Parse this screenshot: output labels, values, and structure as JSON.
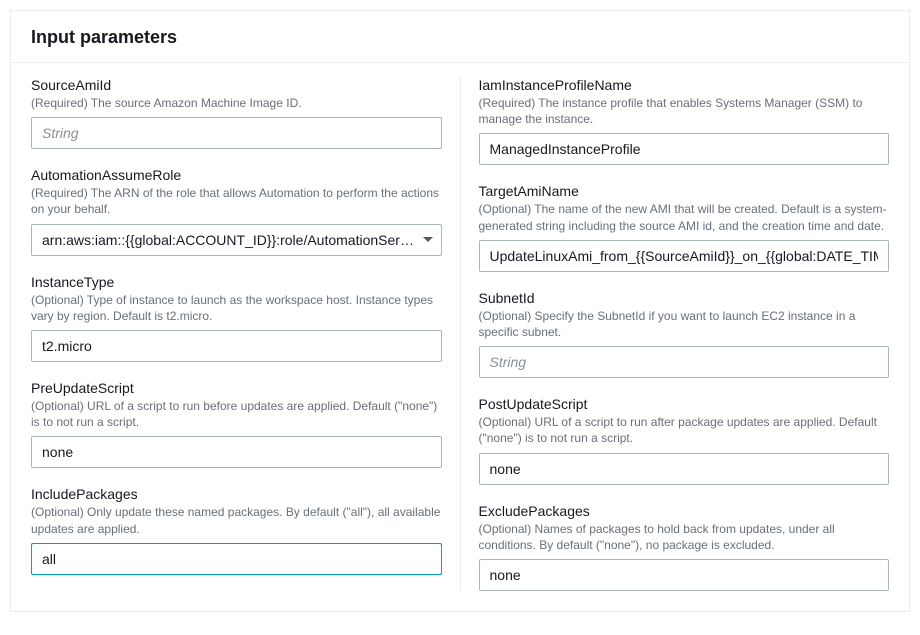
{
  "header": {
    "title": "Input parameters"
  },
  "placeholders": {
    "string": "String"
  },
  "left": {
    "sourceAmiId": {
      "label": "SourceAmiId",
      "desc": "(Required) The source Amazon Machine Image ID.",
      "value": ""
    },
    "automationAssumeRole": {
      "label": "AutomationAssumeRole",
      "desc": "(Required) The ARN of the role that allows Automation to perform the actions on your behalf.",
      "value": "arn:aws:iam::{{global:ACCOUNT_ID}}:role/AutomationSer…"
    },
    "instanceType": {
      "label": "InstanceType",
      "desc": "(Optional) Type of instance to launch as the workspace host. Instance types vary by region. Default is t2.micro.",
      "value": "t2.micro"
    },
    "preUpdateScript": {
      "label": "PreUpdateScript",
      "desc": "(Optional) URL of a script to run before updates are applied. Default (\"none\") is to not run a script.",
      "value": "none"
    },
    "includePackages": {
      "label": "IncludePackages",
      "desc": "(Optional) Only update these named packages. By default (\"all\"), all available updates are applied.",
      "value": "all"
    }
  },
  "right": {
    "iamInstanceProfileName": {
      "label": "IamInstanceProfileName",
      "desc": "(Required) The instance profile that enables Systems Manager (SSM) to manage the instance.",
      "value": "ManagedInstanceProfile"
    },
    "targetAmiName": {
      "label": "TargetAmiName",
      "desc": "(Optional) The name of the new AMI that will be created. Default is a system-generated string including the source AMI id, and the creation time and date.",
      "value": "UpdateLinuxAmi_from_{{SourceAmiId}}_on_{{global:DATE_TIME}}"
    },
    "subnetId": {
      "label": "SubnetId",
      "desc": "(Optional) Specify the SubnetId if you want to launch EC2 instance in a specific subnet.",
      "value": ""
    },
    "postUpdateScript": {
      "label": "PostUpdateScript",
      "desc": "(Optional) URL of a script to run after package updates are applied. Default (\"none\") is to not run a script.",
      "value": "none"
    },
    "excludePackages": {
      "label": "ExcludePackages",
      "desc": "(Optional) Names of packages to hold back from updates, under all conditions. By default (\"none\"), no package is excluded.",
      "value": "none"
    }
  }
}
